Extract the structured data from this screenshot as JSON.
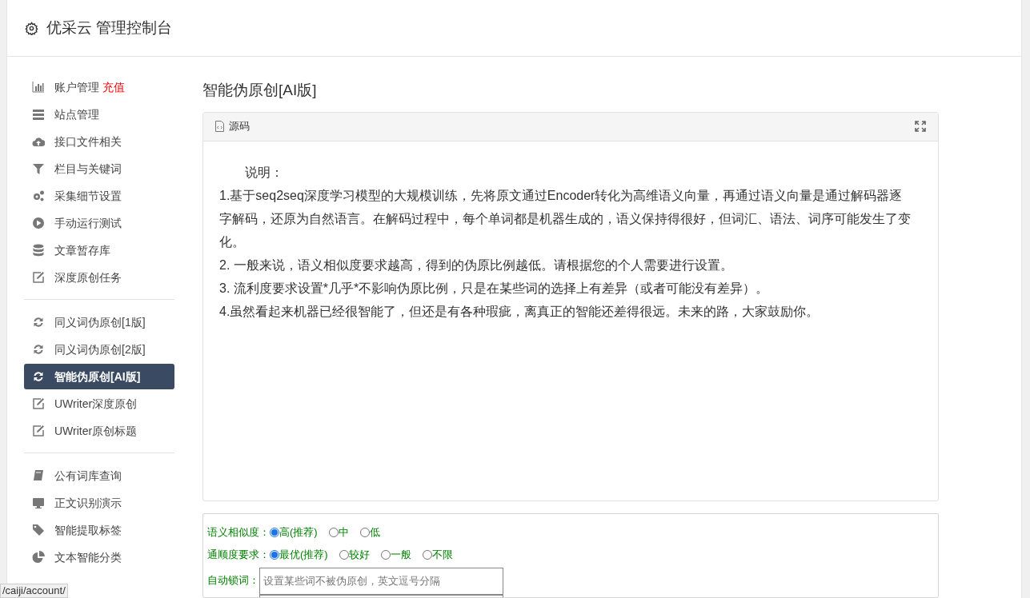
{
  "header": {
    "title": "优采云 管理控制台"
  },
  "sidebar": {
    "groups": [
      [
        {
          "kind": "chart",
          "label": "账户管理",
          "badge": "充值",
          "selected": false
        },
        {
          "kind": "server",
          "label": "站点管理",
          "selected": false
        },
        {
          "kind": "cloud",
          "label": "接口文件相关",
          "selected": false
        },
        {
          "kind": "filter",
          "label": "栏目与关键词",
          "selected": false
        },
        {
          "kind": "gears",
          "label": "采集细节设置",
          "selected": false
        },
        {
          "kind": "play",
          "label": "手动运行测试",
          "selected": false
        },
        {
          "kind": "database",
          "label": "文章暂存库",
          "selected": false
        },
        {
          "kind": "edit",
          "label": "深度原创任务",
          "selected": false
        }
      ],
      [
        {
          "kind": "refresh",
          "label": "同义词伪原创[1版]",
          "selected": false
        },
        {
          "kind": "refresh",
          "label": "同义词伪原创[2版]",
          "selected": false
        },
        {
          "kind": "refresh",
          "label": "智能伪原创[AI版]",
          "selected": true
        },
        {
          "kind": "edit",
          "label": "UWriter深度原创",
          "selected": false
        },
        {
          "kind": "edit",
          "label": "UWriter原创标题",
          "selected": false
        }
      ],
      [
        {
          "kind": "book",
          "label": "公有词库查询",
          "selected": false
        },
        {
          "kind": "monitor",
          "label": "正文识别演示",
          "selected": false
        },
        {
          "kind": "tag",
          "label": "智能提取标签",
          "selected": false
        },
        {
          "kind": "pie",
          "label": "文本智能分类",
          "selected": false
        }
      ]
    ]
  },
  "main": {
    "title": "智能伪原创[AI版]",
    "editor": {
      "tab": "源码",
      "intro": "说明：",
      "lines": [
        "1.基于seq2seq深度学习模型的大规模训练，先将原文通过Encoder转化为高维语义向量，再通过语义向量是通过解码器逐字解码，还原为自然语言。在解码过程中，每个单词都是机器生成的，语义保持得很好，但词汇、语法、词序可能发生了变化。",
        "2. 一般来说，语义相似度要求越高，得到的伪原比例越低。请根据您的个人需要进行设置。",
        "3. 流利度要求设置*几乎*不影响伪原比例，只是在某些词的选择上有差异（或者可能没有差异）。",
        "4.虽然看起来机器已经很智能了，但还是有各种瑕疵，离真正的智能还差得很远。未来的路，大家鼓励你。"
      ]
    },
    "options": [
      {
        "label": "语义相似度：",
        "choices": [
          {
            "text": "高(推荐)",
            "selected": true
          },
          {
            "text": "中",
            "selected": false
          },
          {
            "text": "低",
            "selected": false
          }
        ]
      },
      {
        "label": "通顺度要求：",
        "choices": [
          {
            "text": "最优(推荐)",
            "selected": true
          },
          {
            "text": "较好",
            "selected": false
          },
          {
            "text": "一般",
            "selected": false
          },
          {
            "text": "不限",
            "selected": false
          }
        ]
      }
    ],
    "lock": {
      "label": "自动锁词：",
      "placeholder": "设置某些词不被伪原创，英文逗号分隔"
    }
  },
  "status_url": "/caiji/account/"
}
